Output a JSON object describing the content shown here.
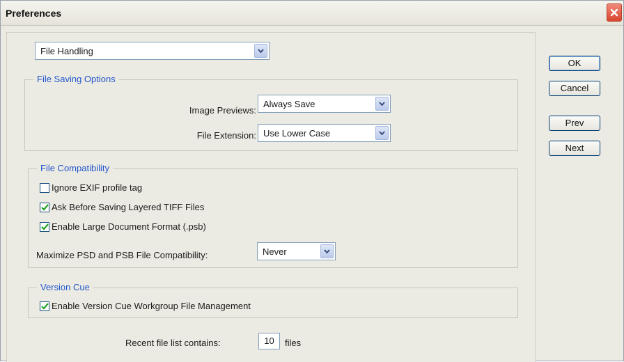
{
  "window": {
    "title": "Preferences"
  },
  "section_select": {
    "value": "File Handling"
  },
  "file_saving_options": {
    "legend": "File Saving Options",
    "image_previews": {
      "label": "Image Previews:",
      "value": "Always Save"
    },
    "file_extension": {
      "label": "File Extension:",
      "value": "Use Lower Case"
    }
  },
  "file_compatibility": {
    "legend": "File Compatibility",
    "ignore_exif": {
      "label": "Ignore EXIF profile tag",
      "checked": false
    },
    "ask_before_saving": {
      "label": "Ask Before Saving Layered TIFF Files",
      "checked": true
    },
    "enable_large_doc": {
      "label": "Enable Large Document Format (.psb)",
      "checked": true
    },
    "maximize": {
      "label": "Maximize PSD and PSB File Compatibility:",
      "value": "Never"
    }
  },
  "version_cue": {
    "legend": "Version Cue",
    "enable_vc": {
      "label": "Enable Version Cue Workgroup File Management",
      "checked": true
    }
  },
  "recent_files": {
    "label": "Recent file list contains:",
    "value": "10",
    "suffix": "files"
  },
  "buttons": {
    "ok": "OK",
    "cancel": "Cancel",
    "prev": "Prev",
    "next": "Next"
  }
}
